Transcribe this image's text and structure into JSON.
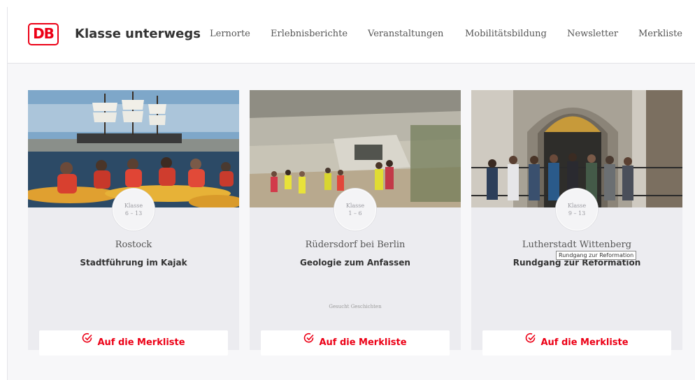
{
  "header": {
    "logo": "DB",
    "brand": "Klasse unterwegs",
    "nav": [
      "Lernorte",
      "Erlebnisberichte",
      "Veranstaltungen",
      "Mobilitätsbildung",
      "Newsletter",
      "Merkliste"
    ]
  },
  "cards": [
    {
      "class_label": "Klasse",
      "class_range": "6 – 13",
      "city": "Rostock",
      "title": "Stadtführung im Kajak",
      "meta": "",
      "merk_label": "Auf die Merkliste",
      "image": "kayak-tall-ship-photo"
    },
    {
      "class_label": "Klasse",
      "class_range": "1 – 6",
      "city": "Rüdersdorf bei Berlin",
      "title": "Geologie zum Anfassen",
      "meta": "Gesucht Geschichten",
      "merk_label": "Auf die Merkliste",
      "image": "quarry-children-photo"
    },
    {
      "class_label": "Klasse",
      "class_range": "9 – 13",
      "city": "Lutherstadt Wittenberg",
      "title": "Rundgang zur Reformation",
      "meta": "",
      "merk_label": "Auf die Merkliste",
      "image": "church-portal-group-photo"
    }
  ],
  "tooltip": "Rundgang zur Reformation",
  "colors": {
    "accent": "#ec0016",
    "card_bg": "#ececf0",
    "text": "#333333"
  }
}
